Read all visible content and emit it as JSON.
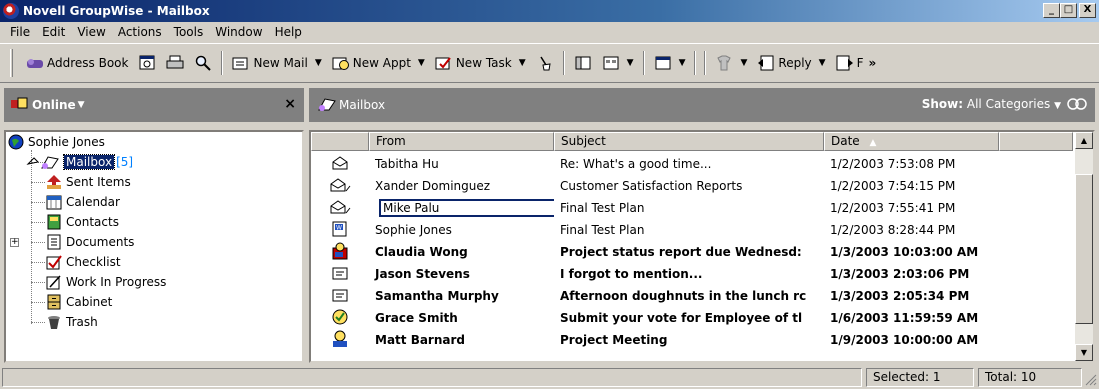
{
  "window": {
    "title": "Novell GroupWise - Mailbox",
    "buttons": {
      "minimize": "_",
      "maximize": "□",
      "close": "X"
    }
  },
  "menu": [
    "File",
    "Edit",
    "View",
    "Actions",
    "Tools",
    "Window",
    "Help"
  ],
  "toolbar": {
    "address_book": "Address Book",
    "new_mail": "New Mail",
    "new_appt": "New Appt",
    "new_task": "New Task",
    "reply": "Reply",
    "forward_partial": "F",
    "overflow": "»"
  },
  "left_pane": {
    "header": "Online",
    "close": "×",
    "tree": {
      "root": "Sophie Jones",
      "items": [
        {
          "label": "Mailbox",
          "count": "[5]"
        },
        {
          "label": "Sent Items"
        },
        {
          "label": "Calendar"
        },
        {
          "label": "Contacts"
        },
        {
          "label": "Documents"
        },
        {
          "label": "Checklist"
        },
        {
          "label": "Work In Progress"
        },
        {
          "label": "Cabinet"
        },
        {
          "label": "Trash"
        }
      ]
    }
  },
  "right_pane": {
    "folder": "Mailbox",
    "show_label": "Show:",
    "show_value": "All Categories",
    "columns": {
      "from": "From",
      "subject": "Subject",
      "date": "Date"
    },
    "rows": [
      {
        "from": "Tabitha Hu",
        "subject": "Re: What's a good time...",
        "date": "1/2/2003 7:53:08 PM"
      },
      {
        "from": "Xander Dominguez",
        "subject": "Customer Satisfaction Reports",
        "date": "1/2/2003 7:54:15 PM"
      },
      {
        "from": "Mike Palu",
        "subject": "Final Test Plan",
        "date": "1/2/2003 7:55:41 PM"
      },
      {
        "from": "Sophie Jones",
        "subject": "Final Test Plan",
        "date": "1/2/2003 8:28:44 PM"
      },
      {
        "from": "Claudia Wong",
        "subject": "Project status report due Wednesd:",
        "date": "1/3/2003 10:03:00 AM"
      },
      {
        "from": "Jason Stevens",
        "subject": "I forgot to mention...",
        "date": "1/3/2003 2:03:06 PM"
      },
      {
        "from": "Samantha Murphy",
        "subject": "Afternoon doughnuts in the lunch rc",
        "date": "1/3/2003 2:05:34 PM"
      },
      {
        "from": "Grace Smith",
        "subject": "Submit your vote for Employee of tl",
        "date": "1/6/2003 11:59:59 AM"
      },
      {
        "from": "Matt Barnard",
        "subject": "Project Meeting",
        "date": "1/9/2003 10:00:00 AM"
      }
    ]
  },
  "status": {
    "selected": "Selected: 1",
    "total": "Total: 10"
  }
}
